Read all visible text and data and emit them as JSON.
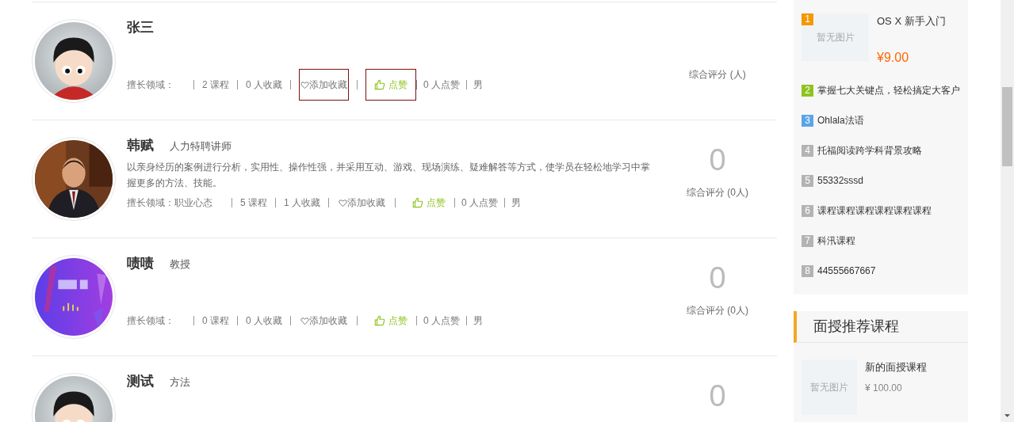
{
  "teachers": [
    {
      "name": "张三",
      "avatar": {
        "kind": "cartoon"
      },
      "domain_label": "擅长领域：",
      "courses": "2 课程",
      "favorites": "0 人收藏",
      "favorite_action": {
        "label": "添加收藏",
        "outlined": true
      },
      "like_action": {
        "label": "点赞",
        "outlined": true
      },
      "likes": "0 人点赞",
      "gender": "男",
      "score_label": "综合评分 (人)"
    },
    {
      "name": "韩赋",
      "title": "人力特聘讲师",
      "description": "以亲身经历的案例进行分析，实用性、操作性强，并采用互动、游戏、现场演练、疑难解答等方式，使学员在轻松地学习中掌握更多的方法、技能。",
      "domain_label": "擅长领域：",
      "domain": "职业心态",
      "courses": "5 课程",
      "favorites": "1 人收藏",
      "favorite_action": {
        "label": "添加收藏",
        "outlined": false
      },
      "like_action": {
        "label": "点赞",
        "outlined": false
      },
      "likes": "0 人点赞",
      "gender": "男",
      "score": "0",
      "score_label": "综合评分 (0人)"
    },
    {
      "name": "啧啧",
      "title": "教授",
      "avatar": {
        "kind": "banner"
      },
      "domain_label": "擅长领域：",
      "courses": "0 课程",
      "favorites": "0 人收藏",
      "favorite_action": {
        "label": "添加收藏",
        "outlined": false
      },
      "like_action": {
        "label": "点赞",
        "outlined": false
      },
      "likes": "0 人点赞",
      "gender": "男",
      "score": "0",
      "score_label": "综合评分 (0人)"
    },
    {
      "name": "测试",
      "title": "方法",
      "avatar": {
        "kind": "cartoon"
      },
      "score": "0"
    }
  ],
  "hot_courses": [
    {
      "rank": "1",
      "color": "#f39800",
      "title": "OS X 新手入门",
      "image_placeholder": "暂无图片",
      "price": "¥9.00"
    },
    {
      "rank": "2",
      "color": "#8fc31f",
      "title": "掌握七大关键点，轻松搞定大客户"
    },
    {
      "rank": "3",
      "color": "#5ba4e6",
      "title": "Ohlala法语"
    },
    {
      "rank": "4",
      "color": "#b3b3b3",
      "title": "托福阅读跨学科背景攻略"
    },
    {
      "rank": "5",
      "color": "#b3b3b3",
      "title": "55332sssd"
    },
    {
      "rank": "6",
      "color": "#b3b3b3",
      "title": "课程课程课程课程课程课程"
    },
    {
      "rank": "7",
      "color": "#b3b3b3",
      "title": "科汛课程"
    },
    {
      "rank": "8",
      "color": "#b3b3b3",
      "title": "44555667667"
    }
  ],
  "offline_panel": {
    "title": "面授推荐课程",
    "courses": [
      {
        "title": "新的面授课程",
        "image_placeholder": "暂无图片",
        "price": "¥ 100.00"
      }
    ]
  }
}
